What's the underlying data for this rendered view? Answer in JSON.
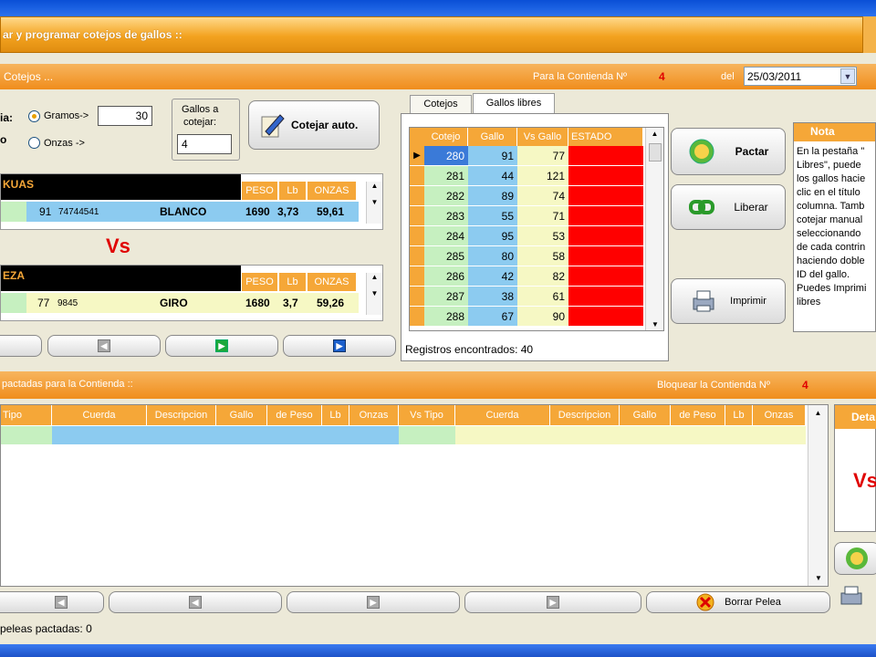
{
  "app": {
    "title": "ar y programar cotejos de gallos ::"
  },
  "cotejos_panel": {
    "header": "Cotejos ...",
    "contienda_label": "Para la Contienda Nº",
    "contienda_num": "4",
    "del_label": "del",
    "date": "25/03/2011",
    "cut_label_1": "ia:",
    "cut_label_2": "o",
    "gramos_label": "Gramos->",
    "gramos_value": "30",
    "onzas_label": "Onzas ->",
    "gallos_label_1": "Gallos a",
    "gallos_label_2": "cotejar:",
    "gallos_value": "4",
    "cotejar_btn": "Cotejar auto."
  },
  "fighter1": {
    "name": "KUAS",
    "cols": [
      "PESO",
      "Lb",
      "ONZAS"
    ],
    "gallo": "91",
    "anillo": "74744541",
    "color": "BLANCO",
    "peso": "1690",
    "lb": "3,73",
    "onzas": "59,61"
  },
  "vs": "Vs",
  "fighter2": {
    "name": "EZA",
    "cols": [
      "PESO",
      "Lb",
      "ONZAS"
    ],
    "gallo": "77",
    "anillo": "9845",
    "color": "GIRO",
    "peso": "1680",
    "lb": "3,7",
    "onzas": "59,26"
  },
  "tabs": [
    "Cotejos",
    "Gallos libres"
  ],
  "cotejos_grid": {
    "headers": [
      "Cotejo",
      "Gallo",
      "Vs Gallo",
      "ESTADO"
    ],
    "rows": [
      [
        "280",
        "91",
        "77"
      ],
      [
        "281",
        "44",
        "121"
      ],
      [
        "282",
        "89",
        "74"
      ],
      [
        "283",
        "55",
        "71"
      ],
      [
        "284",
        "95",
        "53"
      ],
      [
        "285",
        "80",
        "58"
      ],
      [
        "286",
        "42",
        "82"
      ],
      [
        "287",
        "38",
        "61"
      ],
      [
        "288",
        "67",
        "90"
      ]
    ],
    "footer": "Registros encontrados: 40"
  },
  "actions": {
    "pactar": "Pactar",
    "liberar": "Liberar",
    "imprimir": "Imprimir"
  },
  "nota": {
    "title": "Nota",
    "lines": [
      "En la pestaña \"",
      "Libres\", puede",
      "los gallos hacie",
      "clic en el título",
      "columna. Tamb",
      "cotejar manual",
      "seleccionando",
      "de cada contrin",
      "haciendo doble",
      "ID del gallo.",
      "Puedes Imprimi",
      "libres"
    ]
  },
  "peleas_panel": {
    "header": "pactadas para la Contienda ::",
    "bloquear_label": "Bloquear la Contienda Nº",
    "bloquear_num": "4",
    "headers": [
      "Tipo",
      "Cuerda",
      "Descripcion",
      "Gallo",
      "de Peso",
      "Lb",
      "Onzas",
      "Vs Tipo",
      "Cuerda",
      "Descripcion",
      "Gallo",
      "de Peso",
      "Lb",
      "Onzas"
    ],
    "borrar_btn": "Borrar Pelea",
    "footer": "peleas pactadas: 0",
    "side_header": "Deta",
    "side_vs": "Vs"
  },
  "colors": {
    "orange": "#f5a738",
    "red": "#ff0000",
    "blue": "#8ccbf0",
    "green": "#c6f0c0",
    "yellow": "#f6f8c4"
  }
}
